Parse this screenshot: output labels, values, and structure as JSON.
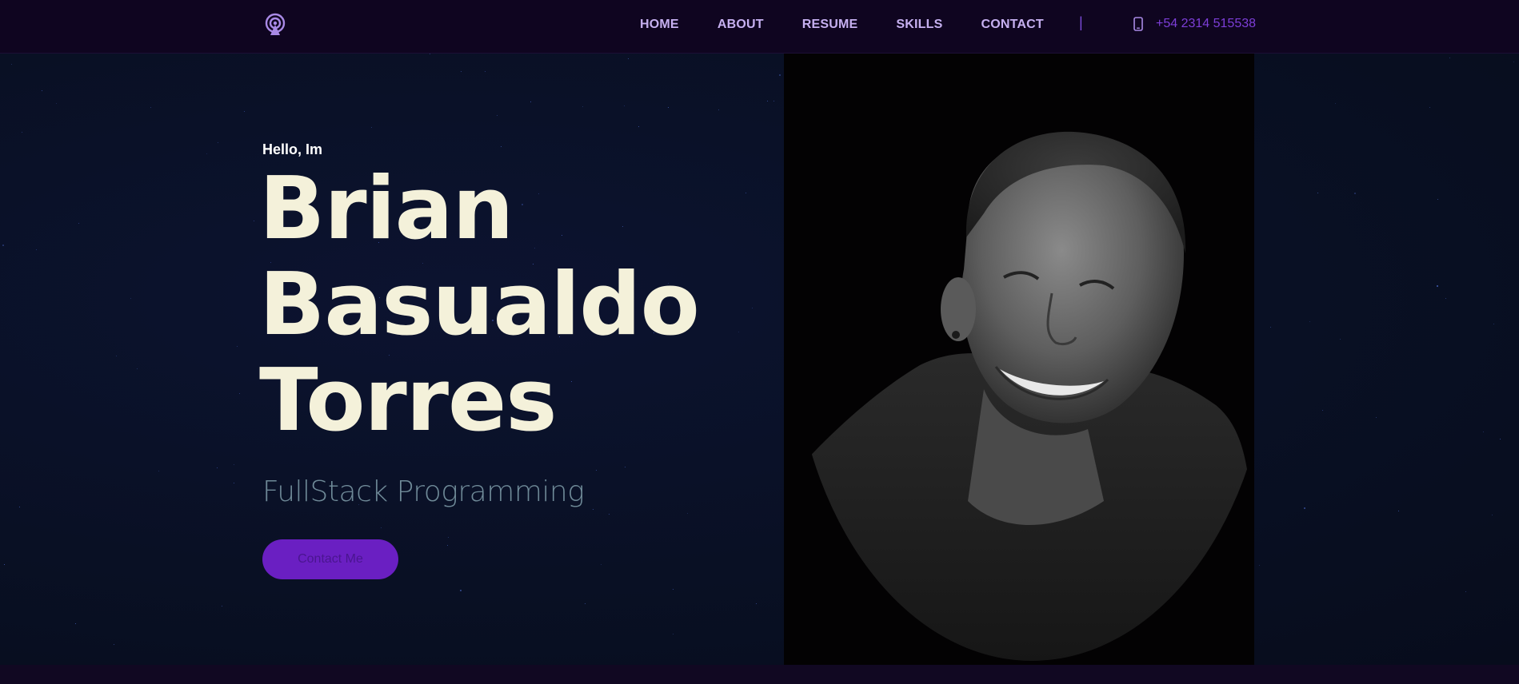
{
  "nav": {
    "logo_icon": "podcast-antenna-icon",
    "links": [
      {
        "label": "HOME"
      },
      {
        "label": "ABOUT"
      },
      {
        "label": "RESUME"
      },
      {
        "label": "SKILLS"
      },
      {
        "label": "CONTACT"
      }
    ],
    "divider": "|",
    "phone_icon": "mobile-phone-icon",
    "phone": "+54 2314 515538"
  },
  "hero": {
    "greeting": "Hello, Im",
    "name_lines": [
      "Brian",
      "Basualdo",
      "Torres"
    ],
    "subtitle": "FullStack Programming",
    "cta_label": "Contact Me",
    "photo": "portrait-photo"
  },
  "colors": {
    "nav_bg": "#0f0520",
    "hero_bg": "#091024",
    "name": "#f4f1da",
    "accent": "#6a1fc2",
    "nav_link": "#c6b0f0",
    "phone": "#7d3ed8"
  }
}
